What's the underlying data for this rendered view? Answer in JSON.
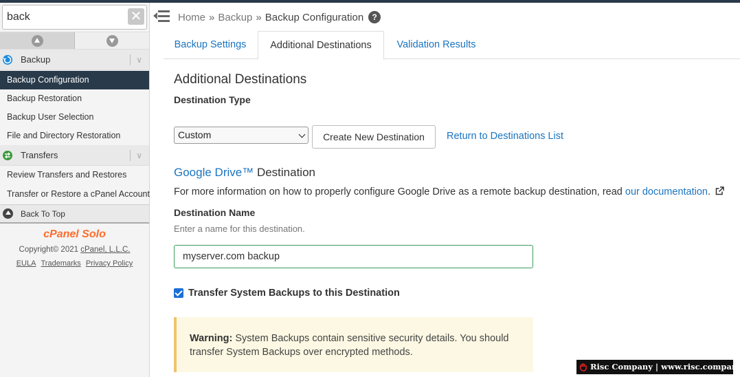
{
  "search": {
    "value": "back",
    "clear_glyph": "✕"
  },
  "sidebar": {
    "groups": [
      {
        "label": "Backup",
        "chevron": "∨",
        "icon": "backup-icon",
        "icon_color": "#1a8be0"
      },
      {
        "label": "Transfers",
        "chevron": "∨",
        "icon": "transfers-icon",
        "icon_color": "#3a9a3a"
      }
    ],
    "items": [
      {
        "label": "Backup Configuration",
        "active": true
      },
      {
        "label": "Backup Restoration"
      },
      {
        "label": "Backup User Selection"
      },
      {
        "label": "File and Directory Restoration"
      },
      {
        "label": "Review Transfers and Restores"
      },
      {
        "label": "Transfer or Restore a cPanel Account"
      }
    ],
    "back_to_top": "Back To Top",
    "brand": "cPanel Solo",
    "copyright_prefix": "Copyright© 2021 ",
    "copyright_link": "cPanel, L.L.C.",
    "footer_links": [
      "EULA",
      "Trademarks",
      "Privacy Policy"
    ]
  },
  "breadcrumb": {
    "items": [
      "Home",
      "Backup",
      "Backup Configuration"
    ],
    "separator": "»",
    "help_glyph": "?"
  },
  "tabs": [
    "Backup Settings",
    "Additional Destinations",
    "Validation Results"
  ],
  "active_tab": "Additional Destinations",
  "main": {
    "title": "Additional Destinations",
    "destination_type_label": "Destination Type",
    "destination_type_value": "Custom",
    "create_button": "Create New Destination",
    "return_link": "Return to Destinations List",
    "provider_name": "Google Drive™",
    "provider_suffix": " Destination",
    "info_text": "For more information on how to properly configure Google Drive as a remote backup destination, read ",
    "info_link": "our documentation",
    "info_end": ".",
    "name_label": "Destination Name",
    "name_help": "Enter a name for this destination.",
    "name_value": "myserver.com backup",
    "checkbox_label": "Transfer System Backups to this Destination",
    "checkbox_checked": true,
    "warning_title": "Warning:",
    "warning_text": " System Backups contain sensitive security details. You should transfer System Backups over encrypted methods."
  },
  "watermark": "Risc Company | www.risc.company",
  "colors": {
    "accent": "#1a74c0",
    "sidebar_active": "#293a4a",
    "brand": "#ff6c2c",
    "warning_bg": "#fcf8e3",
    "input_border": "#3c9b5c"
  }
}
